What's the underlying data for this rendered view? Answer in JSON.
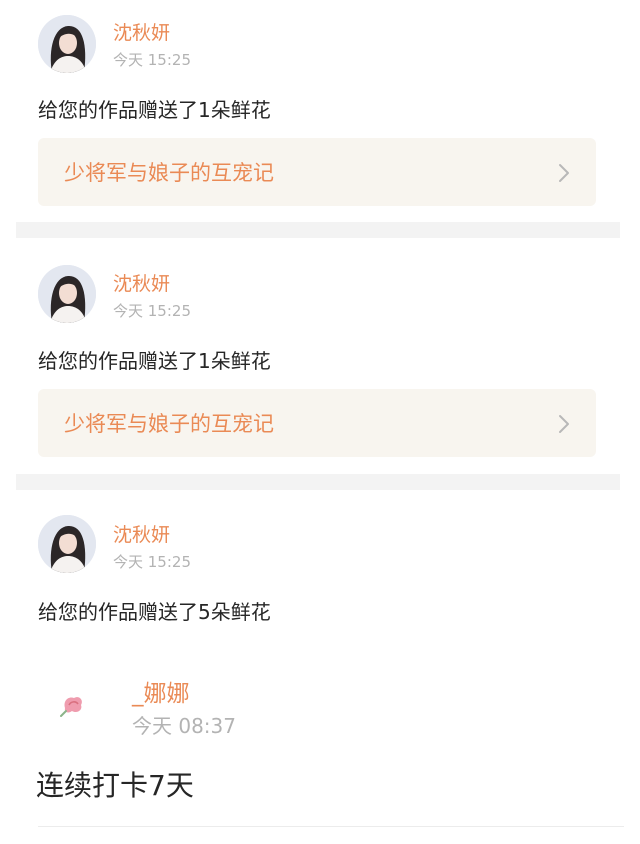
{
  "notifications": [
    {
      "user_name": "沈秋妍",
      "time": "今天 15:25",
      "message": "给您的作品赠送了1朵鲜花",
      "work_title": "少将军与娘子的互宠记"
    },
    {
      "user_name": "沈秋妍",
      "time": "今天 15:25",
      "message": "给您的作品赠送了1朵鲜花",
      "work_title": "少将军与娘子的互宠记"
    },
    {
      "user_name": "沈秋妍",
      "time": "今天 15:25",
      "message": "给您的作品赠送了5朵鲜花"
    }
  ],
  "comment": {
    "user_name": "_娜娜",
    "time": "今天 08:37",
    "text": "连续打卡7天"
  },
  "colors": {
    "accent": "#ea8a55",
    "muted": "#b3b3b3",
    "text": "#262626",
    "card_bg": "#f8f5ef",
    "divider": "#f3f3f3"
  },
  "icons": {
    "chevron": "chevron-right-icon",
    "flower": "flower-icon"
  }
}
